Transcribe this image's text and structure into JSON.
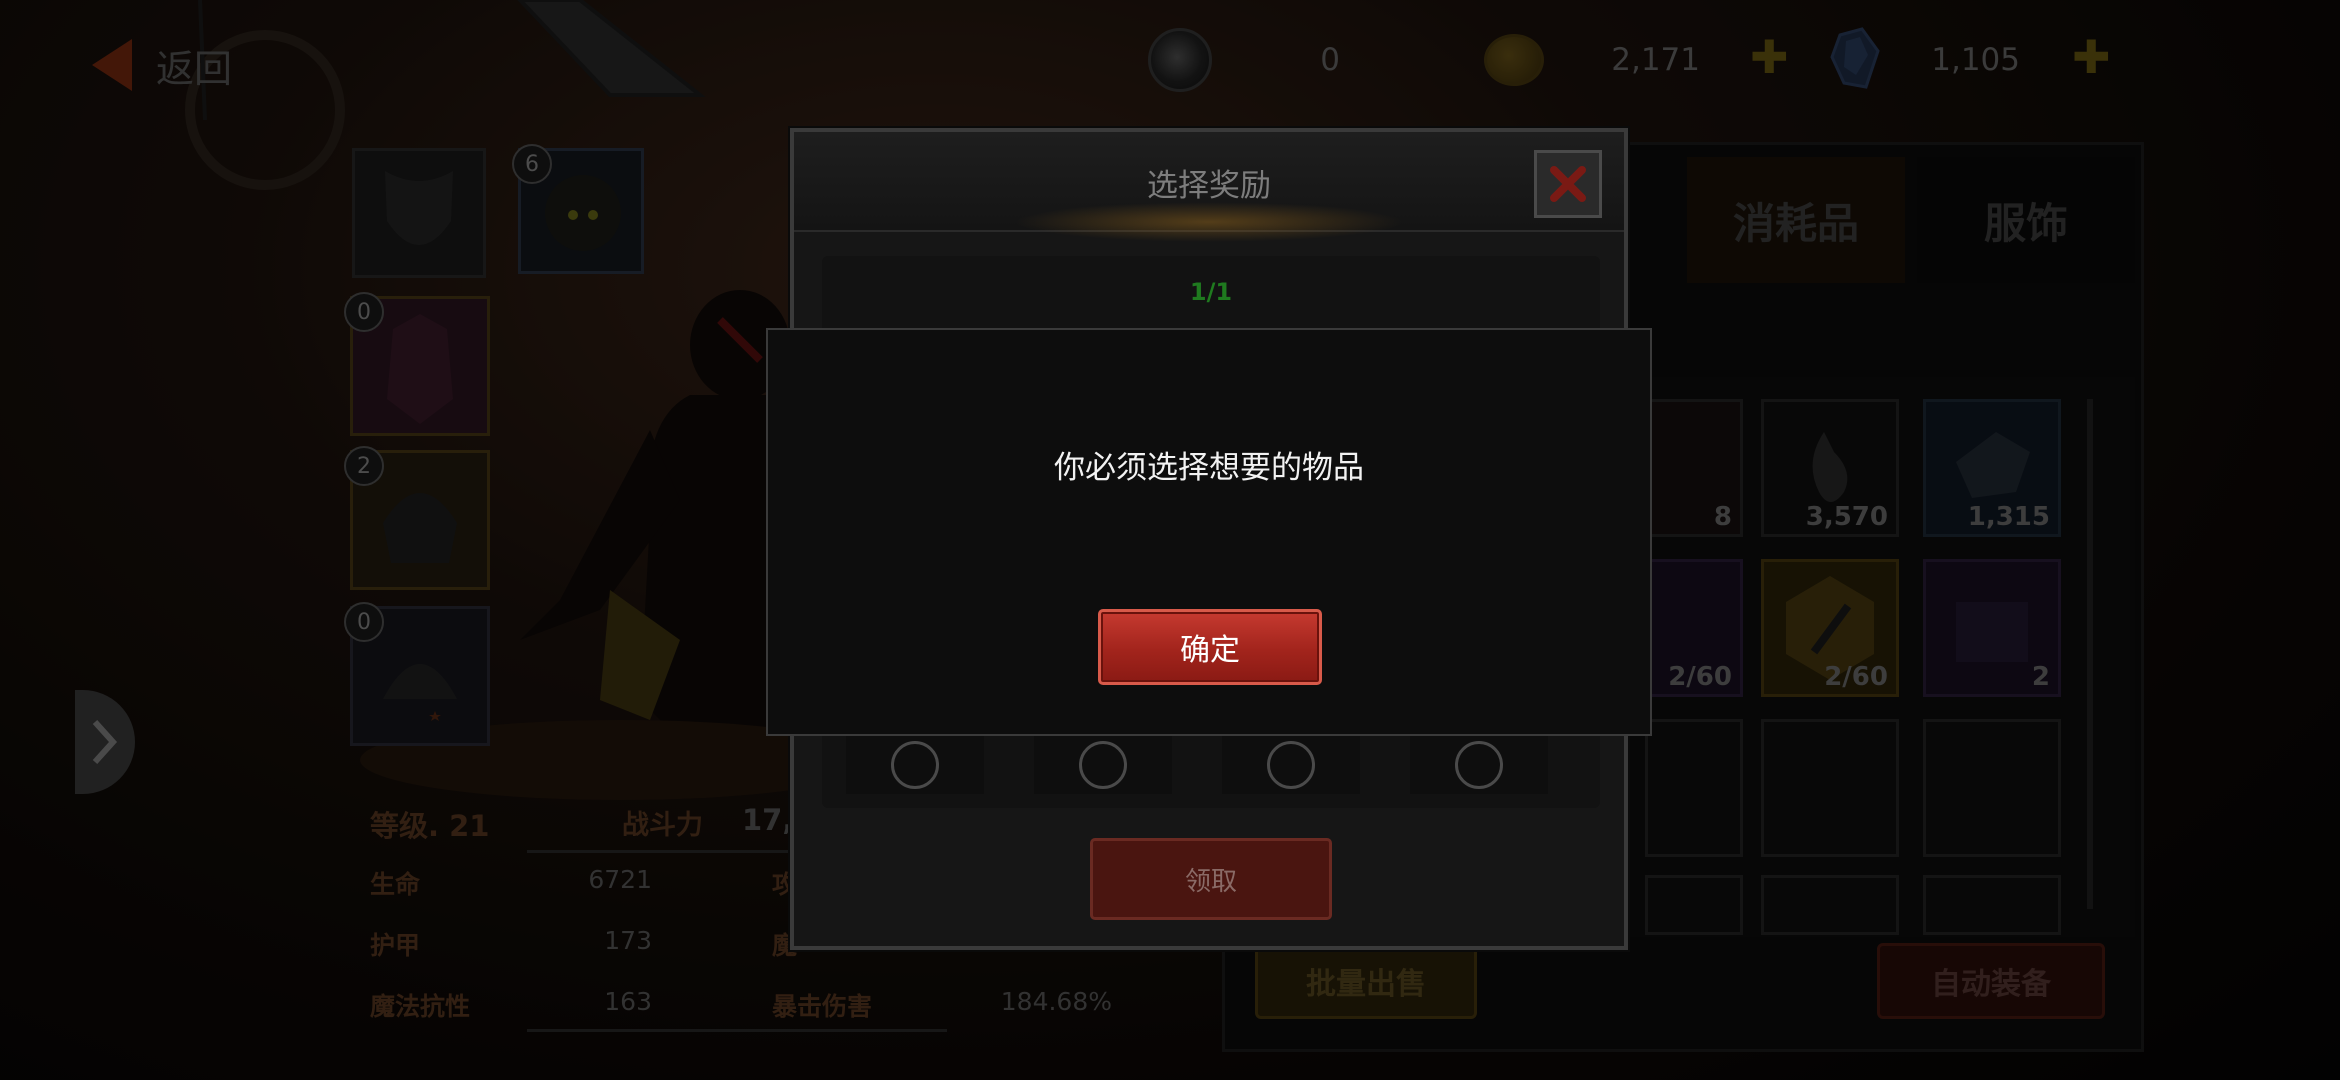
{
  "top_bar": {
    "back_label": "返回",
    "currencies": [
      {
        "icon": "swirl-orb-icon",
        "value": "0"
      },
      {
        "icon": "gold-coin-icon",
        "value": "2,171",
        "has_plus": true
      },
      {
        "icon": "blue-crystal-icon",
        "value": "1,105",
        "has_plus": true
      }
    ],
    "plus_glyph": "✚"
  },
  "equipment": {
    "slot_badges": [
      "6",
      "0",
      "2",
      "0"
    ]
  },
  "stats": {
    "level": "等级. 21",
    "power_label": "战斗力",
    "power_value": "17,",
    "rows": [
      {
        "label": "生命",
        "value": "6721",
        "label2": "攻"
      },
      {
        "label": "护甲",
        "value": "173",
        "label2": "魔"
      },
      {
        "label": "魔法抗性",
        "value": "163",
        "label2": "暴击伤害",
        "value2": "184.68%"
      }
    ]
  },
  "inventory": {
    "tabs": [
      "消耗品",
      "服饰"
    ],
    "counts": [
      "8",
      "3,570",
      "1,315",
      "2/60",
      "2/60",
      "2"
    ],
    "sell_button": "批量出售",
    "auto_equip_button": "自动装备"
  },
  "reward_dialog": {
    "title": "选择奖励",
    "close_icon": "close-x-icon",
    "counter": "1/1",
    "claim_button": "领取"
  },
  "alert": {
    "message": "你必须选择想要的物品",
    "ok_button": "确定"
  },
  "colors": {
    "accent_red": "#c63a30",
    "counter_green": "#1f7a1f",
    "gold": "#6b5a12"
  }
}
